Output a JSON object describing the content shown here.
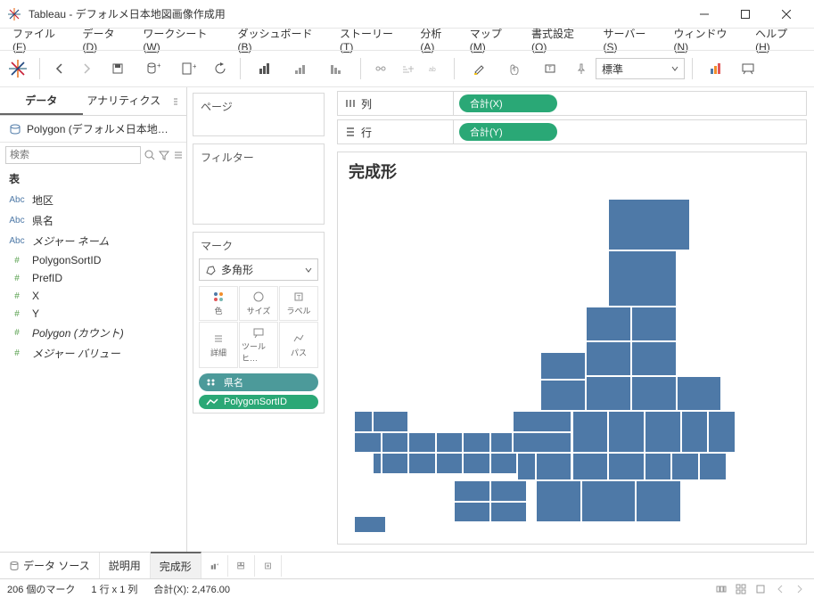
{
  "window": {
    "title": "Tableau - デフォルメ日本地図画像作成用"
  },
  "menu": {
    "items": [
      "ファイル(F)",
      "データ(D)",
      "ワークシート(W)",
      "ダッシュボード(B)",
      "ストーリー(T)",
      "分析(A)",
      "マップ(M)",
      "書式設定(O)",
      "サーバー(S)",
      "ウィンドウ(N)",
      "ヘルプ(H)"
    ]
  },
  "toolbar": {
    "fit_dropdown": "標準"
  },
  "sidebar": {
    "tab_data": "データ",
    "tab_analytics": "アナリティクス",
    "datasource": "Polygon (デフォルメ日本地…",
    "search_placeholder": "検索",
    "tables_hdr": "表",
    "fields": [
      {
        "type": "Abc",
        "cls": "dim",
        "name": "地区",
        "italic": false
      },
      {
        "type": "Abc",
        "cls": "dim",
        "name": "県名",
        "italic": false
      },
      {
        "type": "Abc",
        "cls": "dim",
        "name": "メジャー ネーム",
        "italic": true
      },
      {
        "type": "#",
        "cls": "meas",
        "name": "PolygonSortID",
        "italic": false
      },
      {
        "type": "#",
        "cls": "meas",
        "name": "PrefID",
        "italic": false
      },
      {
        "type": "#",
        "cls": "meas",
        "name": "X",
        "italic": false
      },
      {
        "type": "#",
        "cls": "meas",
        "name": "Y",
        "italic": false
      },
      {
        "type": "#",
        "cls": "meas",
        "name": "Polygon (カウント)",
        "italic": true
      },
      {
        "type": "#",
        "cls": "meas",
        "name": "メジャー バリュー",
        "italic": true
      }
    ]
  },
  "cards": {
    "pages": "ページ",
    "filters": "フィルター",
    "marks": "マーク",
    "mark_type": "多角形",
    "mark_cells": [
      "色",
      "サイズ",
      "ラベル",
      "詳細",
      "ツールヒ…",
      "パス"
    ],
    "pills": [
      {
        "cls": "dim",
        "label": "県名"
      },
      {
        "cls": "meas",
        "label": "PolygonSortID"
      }
    ]
  },
  "shelves": {
    "columns_label": "列",
    "columns_pill": "合計(X)",
    "rows_label": "行",
    "rows_pill": "合計(Y)"
  },
  "viz": {
    "title": "完成形"
  },
  "bottom": {
    "datasource": "データ ソース",
    "tabs": [
      "説明用",
      "完成形"
    ],
    "active": 1
  },
  "status": {
    "marks": "206 個のマーク",
    "dims": "1 行 x 1 列",
    "sum": "合計(X): 2,476.00"
  },
  "chart_data": {
    "type": "area",
    "title": "完成形",
    "xlabel": "合計(X)",
    "ylabel": "合計(Y)",
    "note": "Polygon tile map of Japan by prefecture (47 prefectures). Each rect is one prefecture; positions approximate a stylized Japan layout.",
    "rects": [
      {
        "x": 58,
        "y": 3,
        "w": 18,
        "h": 15
      },
      {
        "x": 58,
        "y": 18,
        "w": 15,
        "h": 16
      },
      {
        "x": 53,
        "y": 34,
        "w": 10,
        "h": 10
      },
      {
        "x": 63,
        "y": 34,
        "w": 10,
        "h": 10
      },
      {
        "x": 53,
        "y": 44,
        "w": 10,
        "h": 10
      },
      {
        "x": 63,
        "y": 44,
        "w": 10,
        "h": 10
      },
      {
        "x": 53,
        "y": 54,
        "w": 10,
        "h": 10
      },
      {
        "x": 63,
        "y": 54,
        "w": 10,
        "h": 10
      },
      {
        "x": 43,
        "y": 47,
        "w": 10,
        "h": 8
      },
      {
        "x": 43,
        "y": 55,
        "w": 10,
        "h": 9
      },
      {
        "x": 73,
        "y": 54,
        "w": 10,
        "h": 10
      },
      {
        "x": 50,
        "y": 64,
        "w": 8,
        "h": 12
      },
      {
        "x": 58,
        "y": 64,
        "w": 8,
        "h": 12
      },
      {
        "x": 66,
        "y": 64,
        "w": 8,
        "h": 12
      },
      {
        "x": 74,
        "y": 64,
        "w": 6,
        "h": 12
      },
      {
        "x": 80,
        "y": 64,
        "w": 6,
        "h": 12
      },
      {
        "x": 37,
        "y": 64,
        "w": 13,
        "h": 6
      },
      {
        "x": 37,
        "y": 70,
        "w": 13,
        "h": 6
      },
      {
        "x": 42,
        "y": 76,
        "w": 8,
        "h": 8
      },
      {
        "x": 50,
        "y": 76,
        "w": 8,
        "h": 8
      },
      {
        "x": 58,
        "y": 76,
        "w": 8,
        "h": 8
      },
      {
        "x": 66,
        "y": 76,
        "w": 6,
        "h": 8
      },
      {
        "x": 72,
        "y": 76,
        "w": 6,
        "h": 8
      },
      {
        "x": 78,
        "y": 76,
        "w": 6,
        "h": 8
      },
      {
        "x": 38,
        "y": 76,
        "w": 4,
        "h": 8
      },
      {
        "x": 26,
        "y": 70,
        "w": 6,
        "h": 6
      },
      {
        "x": 32,
        "y": 70,
        "w": 5,
        "h": 6
      },
      {
        "x": 20,
        "y": 70,
        "w": 6,
        "h": 6
      },
      {
        "x": 14,
        "y": 70,
        "w": 6,
        "h": 6
      },
      {
        "x": 8,
        "y": 70,
        "w": 6,
        "h": 6
      },
      {
        "x": 2,
        "y": 70,
        "w": 6,
        "h": 6
      },
      {
        "x": 20,
        "y": 76,
        "w": 6,
        "h": 6
      },
      {
        "x": 14,
        "y": 76,
        "w": 6,
        "h": 6
      },
      {
        "x": 8,
        "y": 76,
        "w": 6,
        "h": 6
      },
      {
        "x": 26,
        "y": 76,
        "w": 6,
        "h": 6
      },
      {
        "x": 32,
        "y": 76,
        "w": 6,
        "h": 6
      },
      {
        "x": 24,
        "y": 84,
        "w": 8,
        "h": 6
      },
      {
        "x": 32,
        "y": 84,
        "w": 8,
        "h": 6
      },
      {
        "x": 24,
        "y": 90,
        "w": 8,
        "h": 6
      },
      {
        "x": 32,
        "y": 90,
        "w": 8,
        "h": 6
      },
      {
        "x": 42,
        "y": 84,
        "w": 10,
        "h": 12
      },
      {
        "x": 52,
        "y": 84,
        "w": 12,
        "h": 12
      },
      {
        "x": 64,
        "y": 84,
        "w": 10,
        "h": 12
      },
      {
        "x": 6,
        "y": 64,
        "w": 8,
        "h": 6
      },
      {
        "x": 6,
        "y": 76,
        "w": 2,
        "h": 6
      },
      {
        "x": 2,
        "y": 94,
        "w": 7,
        "h": 5
      },
      {
        "x": 2,
        "y": 64,
        "w": 4,
        "h": 6
      }
    ]
  }
}
